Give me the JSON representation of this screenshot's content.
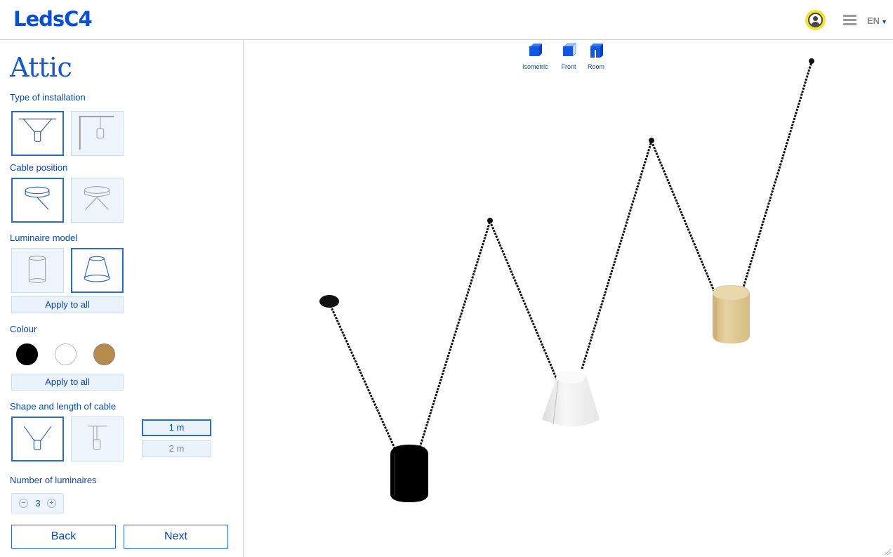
{
  "header": {
    "logo": "LedsC4",
    "language": "EN",
    "icons": {
      "user": "user-circle-icon",
      "menu": "hamburger-menu-icon",
      "caret": "caret-down-icon"
    }
  },
  "sidebar": {
    "title": "Attic",
    "installation": {
      "label": "Type of installation",
      "options": [
        {
          "name": "ceiling-canopy",
          "selected": true
        },
        {
          "name": "wall-bracket",
          "selected": false
        }
      ]
    },
    "cable_position": {
      "label": "Cable position",
      "options": [
        {
          "name": "single-cable",
          "selected": true
        },
        {
          "name": "double-cable",
          "selected": false
        }
      ]
    },
    "model": {
      "label": "Luminaire model",
      "options": [
        {
          "name": "cylinder",
          "selected": false
        },
        {
          "name": "cone",
          "selected": true
        }
      ],
      "apply_label": "Apply to all"
    },
    "colour": {
      "label": "Colour",
      "swatches": [
        {
          "name": "black",
          "color": "#000000",
          "selected": true
        },
        {
          "name": "white",
          "color": "#ffffff",
          "selected": false
        },
        {
          "name": "gold",
          "color": "#b58a4a",
          "selected": false
        }
      ],
      "apply_label": "Apply to all"
    },
    "cable_shape": {
      "label": "Shape and length of cable",
      "options": [
        {
          "name": "v-shape",
          "selected": true
        },
        {
          "name": "straight",
          "selected": false
        }
      ],
      "lengths": [
        {
          "label": "1 m",
          "active": true
        },
        {
          "label": "2 m",
          "active": false
        }
      ]
    },
    "count": {
      "label": "Number of luminaires",
      "value": "3",
      "minus": "−",
      "plus": "+"
    },
    "back_label": "Back",
    "next_label": "Next"
  },
  "viewer": {
    "views": [
      {
        "label": "Isometric",
        "icon": "isometric-cube-icon"
      },
      {
        "label": "Front",
        "icon": "front-cube-icon"
      },
      {
        "label": "Room",
        "icon": "room-cube-icon"
      }
    ],
    "luminaires": [
      {
        "model": "cylinder",
        "color": "#000000"
      },
      {
        "model": "cone",
        "color": "#ffffff"
      },
      {
        "model": "cylinder",
        "color": "#d9c185"
      }
    ]
  }
}
